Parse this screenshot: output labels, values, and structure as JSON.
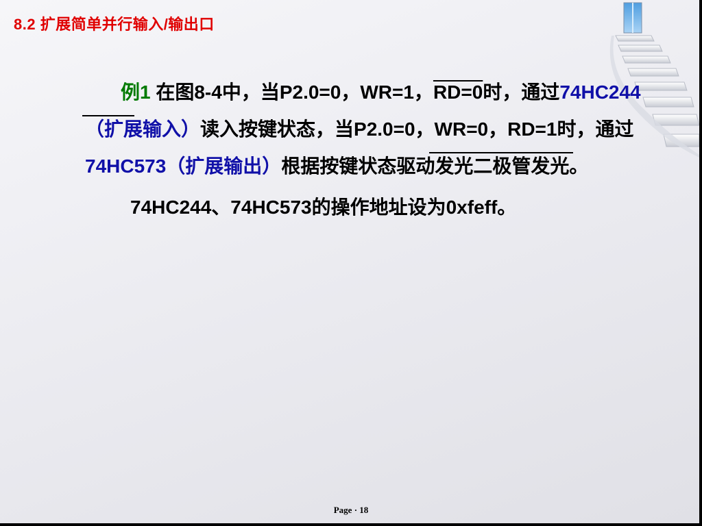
{
  "slide": {
    "title": "8.2  扩展简单并行输入/输出口",
    "para1": {
      "label": "例1",
      "t1": " 在图8-4中，当P2.0=0，WR=1，",
      "rd_overline": "RD=0",
      "t2": "时，通过",
      "chip_in": "74HC244（扩展输入）",
      "t3": "读入按键状态，当P2.0=0，WR=0，RD=1时，通过",
      "chip_out": "74HC573（扩展输出）",
      "t4": "根据按键状态驱动发光二极管发光。"
    },
    "para2": "74HC244、74HC573的操作地址设为0xfeff。"
  },
  "footer": {
    "page_label": "Page",
    "separator": "·",
    "page_number": "18"
  },
  "colors": {
    "title": "#e00000",
    "example_label": "#007a00",
    "chip_text": "#1010a8"
  },
  "icons": {
    "decoration": "staircase-icon"
  }
}
